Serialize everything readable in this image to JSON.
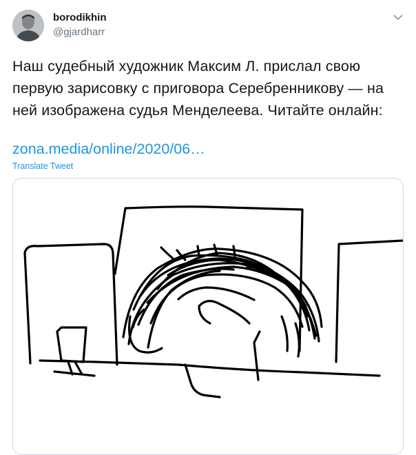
{
  "author": {
    "name": "borodikhin",
    "handle": "@gjardharr",
    "avatar_icon": "user-avatar-photo"
  },
  "tweet": {
    "text": "Наш судебный художник Максим Л. прислал свою первую зарисовку с приговора Серебренникову — на ней изображена судья Менделеева. Читайте онлайн:",
    "link": "zona.media/online/2020/06…",
    "translate_label": "Translate Tweet"
  },
  "menu": {
    "icon": "chevron-down-icon"
  },
  "media": {
    "type": "image",
    "description_icon": "courtroom-sketch-image"
  },
  "colors": {
    "link": "#1b95e0",
    "secondary_text": "#657786",
    "border": "#ccd6dd"
  }
}
